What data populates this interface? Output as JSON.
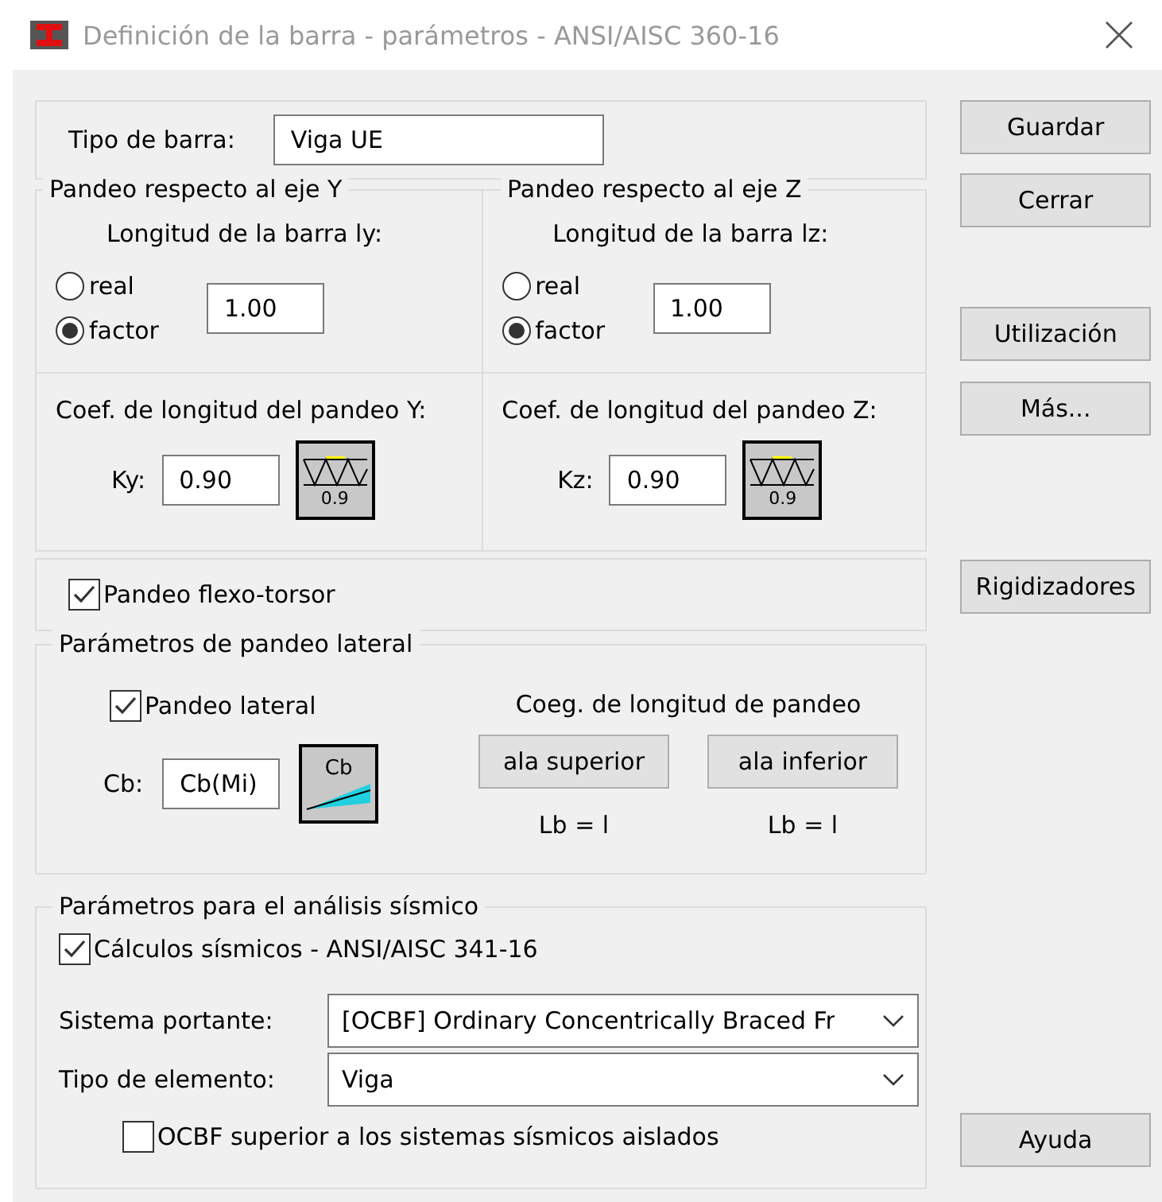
{
  "window": {
    "title": "Definición de la barra - parámetros - ANSI/AISC 360-16"
  },
  "member_type": {
    "label": "Tipo de barra:",
    "value": "Viga UE"
  },
  "buckling": [
    {
      "title": "Pandeo respecto al eje Y",
      "length_label": "Longitud de la barra ly:",
      "options": [
        {
          "label": "real",
          "selected": false
        },
        {
          "label": "factor",
          "selected": true
        }
      ],
      "length_value": "1.00",
      "coef_label": "Coef. de longitud del pandeo Y:",
      "k_label": "Ky:",
      "k_value": "0.90",
      "k_button": "0.9"
    },
    {
      "title": "Pandeo respecto al eje Z",
      "length_label": "Longitud de la barra lz:",
      "options": [
        {
          "label": "real",
          "selected": false
        },
        {
          "label": "factor",
          "selected": true
        }
      ],
      "length_value": "1.00",
      "coef_label": "Coef. de longitud del pandeo Z:",
      "k_label": "Kz:",
      "k_value": "0.90",
      "k_button": "0.9"
    }
  ],
  "flexural_torsional": {
    "label": "Pandeo flexo-torsor",
    "checked": true
  },
  "lateral": {
    "title": "Parámetros de pandeo lateral",
    "check": {
      "label": "Pandeo lateral",
      "checked": true
    },
    "cb_label": "Cb:",
    "cb_value": "Cb(Mi)",
    "cb_button": "Cb",
    "coef_title": "Coeg. de longitud de pandeo",
    "flanges": [
      {
        "button": "ala superior",
        "value": "Lb = l"
      },
      {
        "button": "ala inferior",
        "value": "Lb = l"
      }
    ]
  },
  "seismic": {
    "title": "Parámetros para el análisis sísmico",
    "check": {
      "label": "Cálculos sísmicos - ANSI/AISC 341-16",
      "checked": true
    },
    "fields": [
      {
        "label": "Sistema portante:",
        "value": "[OCBF] Ordinary Concentrically Braced Fr"
      },
      {
        "label": "Tipo de elemento:",
        "value": "Viga"
      }
    ],
    "isolated": {
      "label": "OCBF superior a los sistemas sísmicos aislados",
      "checked": false
    }
  },
  "buttons": [
    "Guardar",
    "Cerrar",
    "Utilización",
    "Más...",
    "Rigidizadores",
    "Ayuda"
  ]
}
